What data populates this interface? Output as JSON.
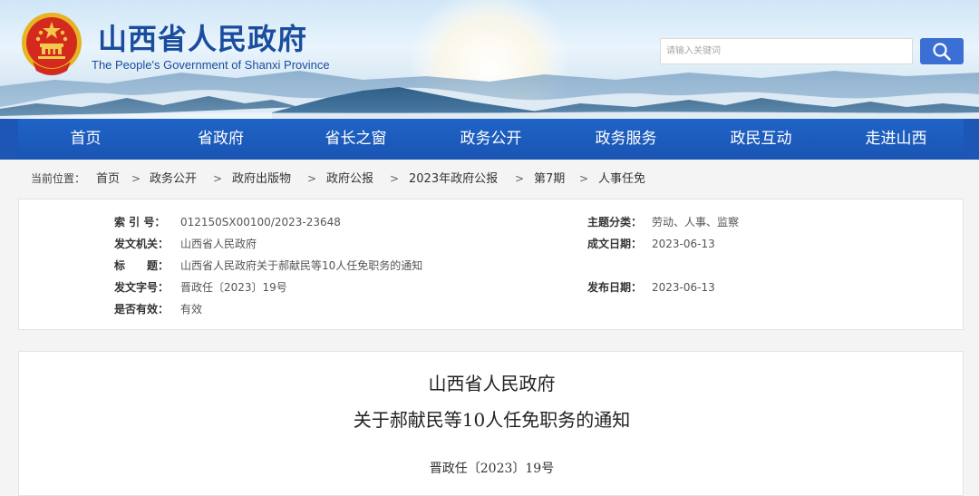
{
  "header": {
    "title_cn": "山西省人民政府",
    "title_en": "The People's Government of Shanxi Province",
    "search_placeholder": "请输入关键词",
    "icons": {
      "emblem": "national-emblem-icon",
      "search": "search-icon"
    },
    "colors": {
      "brand": "#1a4d9e",
      "search_button": "#3b6fd3"
    }
  },
  "nav": {
    "items": [
      "首页",
      "省政府",
      "省长之窗",
      "政务公开",
      "政务服务",
      "政民互动",
      "走进山西"
    ],
    "color": "#1d56b5"
  },
  "breadcrumb": {
    "label": "当前位置：",
    "items": [
      "首页",
      "政务公开",
      "政府出版物",
      "政府公报",
      "2023年政府公报",
      "第7期",
      "人事任免"
    ],
    "separator": ">"
  },
  "meta": {
    "index_key": "索 引 号：",
    "index_val": "012150SX00100/2023-23648",
    "category_key": "主题分类：",
    "category_val": "劳动、人事、监察",
    "issuer_key": "发文机关：",
    "issuer_val": "山西省人民政府",
    "created_key": "成文日期：",
    "created_val": "2023-06-13",
    "title_key": "标　　题：",
    "title_val": "山西省人民政府关于郝献民等10人任免职务的通知",
    "docnum_key": "发文字号：",
    "docnum_val": "晋政任〔2023〕19号",
    "published_key": "发布日期：",
    "published_val": "2023-06-13",
    "valid_key": "是否有效：",
    "valid_val": "有效"
  },
  "document": {
    "title_line1": "山西省人民政府",
    "title_line2": "关于郝献民等10人任免职务的通知",
    "number": "晋政任〔2023〕19号"
  }
}
